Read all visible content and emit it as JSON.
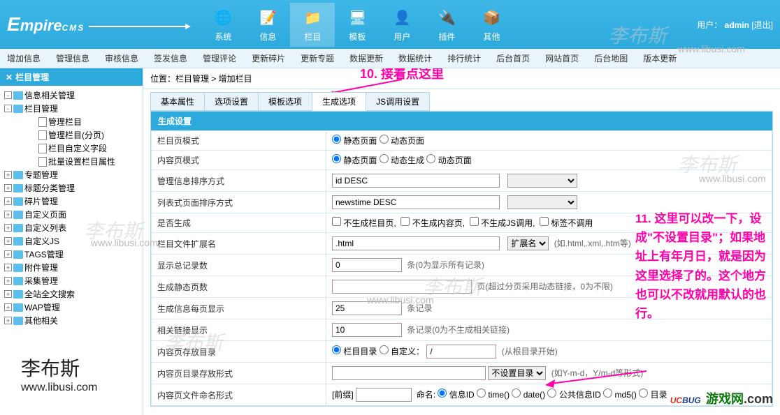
{
  "header": {
    "logo": "EmpireCMS",
    "nav": [
      {
        "label": "系统",
        "icon": "🌐"
      },
      {
        "label": "信息",
        "icon": "📝"
      },
      {
        "label": "栏目",
        "icon": "📁",
        "active": true
      },
      {
        "label": "模板",
        "icon": "🖥"
      },
      {
        "label": "用户",
        "icon": "👤"
      },
      {
        "label": "插件",
        "icon": "🔌"
      },
      {
        "label": "其他",
        "icon": "📦"
      }
    ],
    "user_label": "用户：",
    "username": "admin",
    "logout": "[退出]"
  },
  "menubar": [
    "增加信息",
    "管理信息",
    "审核信息",
    "签发信息",
    "管理评论",
    "更新碎片",
    "更新专题",
    "数据更新",
    "数据统计",
    "排行统计",
    "后台首页",
    "网站首页",
    "后台地图",
    "版本更新"
  ],
  "sidebar": {
    "title": "栏目管理",
    "tree": [
      {
        "pm": "-",
        "label": "信息相关管理",
        "icon": "folder"
      },
      {
        "pm": "-",
        "label": "栏目管理",
        "icon": "folder"
      },
      {
        "pm": "",
        "label": "管理栏目",
        "icon": "doc",
        "sub": true
      },
      {
        "pm": "",
        "label": "管理栏目(分页)",
        "icon": "doc",
        "sub": true
      },
      {
        "pm": "",
        "label": "栏目自定义字段",
        "icon": "doc",
        "sub": true
      },
      {
        "pm": "",
        "label": "批量设置栏目属性",
        "icon": "doc",
        "sub": true
      },
      {
        "pm": "+",
        "label": "专题管理",
        "icon": "folder"
      },
      {
        "pm": "+",
        "label": "标题分类管理",
        "icon": "folder"
      },
      {
        "pm": "+",
        "label": "碎片管理",
        "icon": "folder"
      },
      {
        "pm": "+",
        "label": "自定义页面",
        "icon": "folder"
      },
      {
        "pm": "+",
        "label": "自定义列表",
        "icon": "folder"
      },
      {
        "pm": "+",
        "label": "自定义JS",
        "icon": "folder"
      },
      {
        "pm": "+",
        "label": "TAGS管理",
        "icon": "folder"
      },
      {
        "pm": "+",
        "label": "附件管理",
        "icon": "folder"
      },
      {
        "pm": "+",
        "label": "采集管理",
        "icon": "folder"
      },
      {
        "pm": "+",
        "label": "全站全文搜索",
        "icon": "folder"
      },
      {
        "pm": "+",
        "label": "WAP管理",
        "icon": "folder"
      },
      {
        "pm": "+",
        "label": "其他相关",
        "icon": "folder"
      }
    ]
  },
  "breadcrumb": "位置：栏目管理 > 增加栏目",
  "tabs": [
    "基本属性",
    "选项设置",
    "模板选项",
    "生成选项",
    "JS调用设置"
  ],
  "active_tab": 3,
  "panel_title": "生成设置",
  "form": {
    "row1": {
      "label": "栏目页模式",
      "opt1": "静态页面",
      "opt2": "动态页面"
    },
    "row2": {
      "label": "内容页模式",
      "opt1": "静态页面",
      "opt2": "动态生成",
      "opt3": "动态页面"
    },
    "row3": {
      "label": "管理信息排序方式",
      "value": "id DESC"
    },
    "row4": {
      "label": "列表式页面排序方式",
      "value": "newstime DESC"
    },
    "row5": {
      "label": "是否生成",
      "c1": "不生成栏目页,",
      "c2": "不生成内容页,",
      "c3": "不生成JS调用,",
      "c4": "标签不调用"
    },
    "row6": {
      "label": "栏目文件扩展名",
      "value": ".html",
      "sel": "扩展名",
      "hint": "(如.html,.xml,.htm等)"
    },
    "row7": {
      "label": "显示总记录数",
      "value": "0",
      "hint": "条(0为显示所有记录)"
    },
    "row8": {
      "label": "生成静态页数",
      "value": "",
      "hint": "页(超过分页采用动态链接，0为不限)"
    },
    "row9": {
      "label": "生成信息每页显示",
      "value": "25",
      "hint": "条记录"
    },
    "row10": {
      "label": "相关链接显示",
      "value": "10",
      "hint": "条记录(0为不生成相关链接)"
    },
    "row11": {
      "label": "内容页存放目录",
      "opt1": "栏目目录",
      "opt2": "自定义：",
      "custom": "/",
      "hint": "(从根目录开始)"
    },
    "row12": {
      "label": "内容页目录存放形式",
      "value": "",
      "sel": "不设置目录",
      "hint": "(如Y-m-d，Y/m-d等形式)"
    },
    "row13": {
      "label": "内容页文件命名形式",
      "prefix": "[前缀]",
      "name_label": "命名:",
      "o1": "信息ID",
      "o2": "time()",
      "o3": "date()",
      "o4": "公共信息ID",
      "o5": "md5()",
      "o6": "目录"
    }
  },
  "annotations": {
    "a10": "10. 接着点这里",
    "a11": "11. 这里可以改一下，设成\"不设置目录\"；如果地址上有年月日，就是因为这里选择了的。这个地方也可以不改就用默认的也行。"
  },
  "watermark": {
    "sig": "李布斯",
    "url": "www.libusi.com"
  },
  "ucbug": {
    "uc": "UC",
    "bug": "BUG",
    "cn": "游戏网",
    "com": ".com"
  }
}
